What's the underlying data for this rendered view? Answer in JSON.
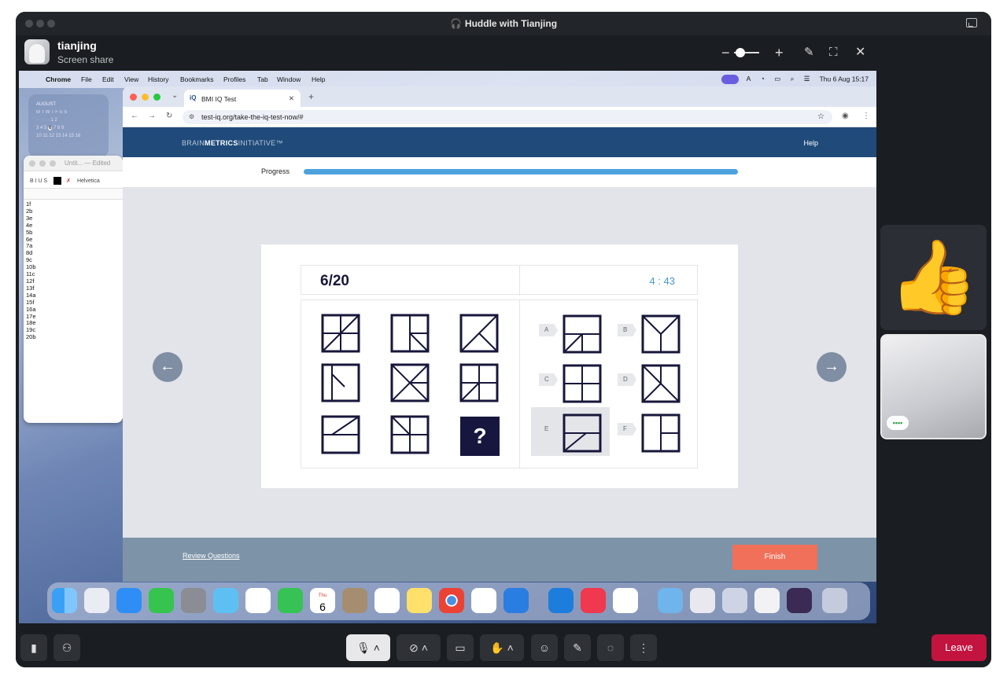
{
  "window": {
    "title": "Huddle with Tianjing"
  },
  "share": {
    "user": "tianjing",
    "subtitle": "Screen share"
  },
  "menubar": {
    "app": "Chrome",
    "items": [
      "File",
      "Edit",
      "View",
      "History",
      "Bookmarks",
      "Profiles",
      "Tab",
      "Window",
      "Help"
    ],
    "datetime": "Thu 6 Aug  15:17"
  },
  "calendar": {
    "month": "AUGUST",
    "today": "6"
  },
  "notes": {
    "title": "Untit... — Edited",
    "font": "Helvetica",
    "lines": [
      "1f",
      "2b",
      "3e",
      "4e",
      "5b",
      "6e",
      "7a",
      "8d",
      "9c",
      "10b",
      "11c",
      "12f",
      "13f",
      "14a",
      "15f",
      "16a",
      "17e",
      "18e",
      "19c",
      "20b"
    ]
  },
  "browser": {
    "tab_title": "BMI IQ Test",
    "url": "test-iq.org/take-the-iq-test-now/#"
  },
  "site": {
    "logo_light": "BRAIN",
    "logo_bold": "METRICS",
    "logo_tail": "INITIATIVE™",
    "help": "Help",
    "progress_label": "Progress",
    "progress_fraction": 1.0
  },
  "quiz": {
    "question": "6/20",
    "timer": "4 : 43",
    "missing": "?",
    "options": [
      "A",
      "B",
      "C",
      "D",
      "E",
      "F"
    ],
    "selected": "E",
    "review": "Review Questions",
    "finish": "Finish"
  },
  "dock": {
    "calendar_day": "6",
    "calendar_weekday": "Thu"
  },
  "controls": {
    "leave": "Leave"
  }
}
